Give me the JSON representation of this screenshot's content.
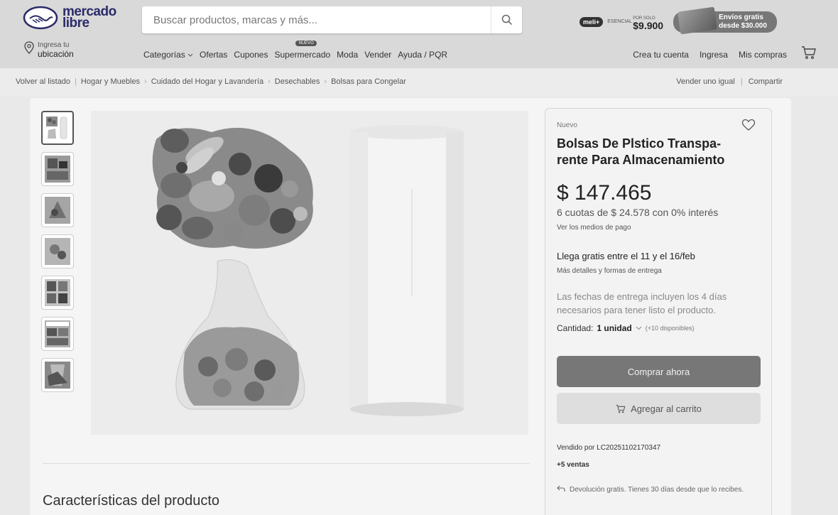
{
  "header": {
    "logo_line1": "mercado",
    "logo_line2": "libre",
    "search_placeholder": "Buscar productos, marcas y más...",
    "promo": {
      "badge": "meli+",
      "badge_sub": "ESENCIAL",
      "price_prefix": "POR SOLO",
      "price": "$9.900",
      "free_shipping_line1": "Envíos gratis",
      "free_shipping_line2": "desde $30.000"
    },
    "location_line1": "Ingresa tu",
    "location_line2": "ubicación",
    "nav": [
      "Categorías",
      "Ofertas",
      "Cupones",
      "Supermercado",
      "Moda",
      "Vender",
      "Ayuda / PQR"
    ],
    "nav_new_badge": "NUEVO",
    "user_nav": [
      "Crea tu cuenta",
      "Ingresa",
      "Mis compras"
    ]
  },
  "breadcrumb": {
    "back": "Volver al listado",
    "items": [
      "Hogar y Muebles",
      "Cuidado del Hogar y Lavandería",
      "Desechables",
      "Bolsas para Congelar"
    ],
    "sell_same": "Vender uno igual",
    "share": "Compartir"
  },
  "product": {
    "condition": "Nuevo",
    "title": "Bolsas De Plstico Transpa-rente Para Almacenamiento",
    "price": "$ 147.465",
    "installments": "6 cuotas de $ 24.578 con 0% interés",
    "payment_link": "Ver los medios de pago",
    "delivery": "Llega gratis entre el 11 y el 16/feb",
    "delivery_details": "Más detalles y formas de entrega",
    "delivery_note": "Las fechas de entrega incluyen los 4 días necesarios para tener listo el producto.",
    "quantity_label": "Cantidad:",
    "quantity_value": "1 unidad",
    "quantity_available": "(+10 disponibles)",
    "buy_now": "Comprar ahora",
    "add_to_cart": "Agregar al carrito",
    "seller_prefix": "Vendido por",
    "seller": "LC20251102170347",
    "sales": "+5 ventas",
    "return_policy": "Devolución gratis. Tienes 30 días desde que lo recibes.",
    "features_title": "Características del producto"
  }
}
